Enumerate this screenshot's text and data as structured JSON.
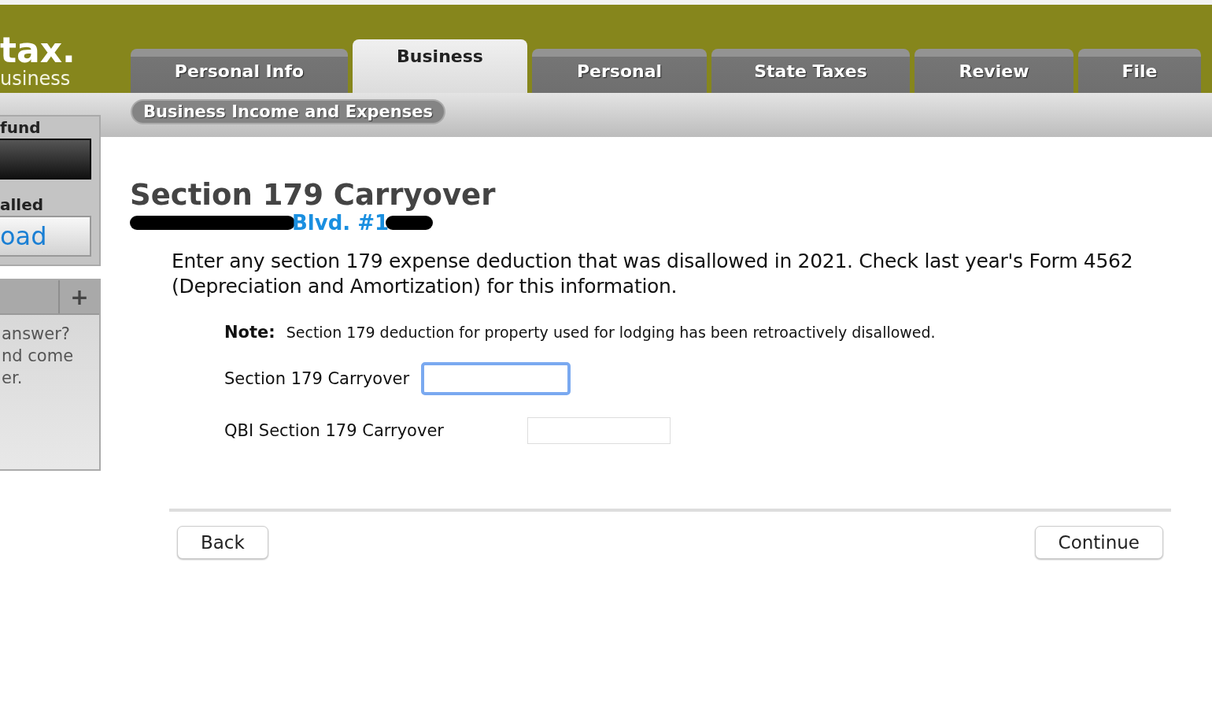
{
  "logo": {
    "mark": "tax.",
    "sub": "usiness"
  },
  "tabs": [
    {
      "label": "Personal Info",
      "selected": false
    },
    {
      "label": "Business",
      "selected": true
    },
    {
      "label": "Personal",
      "selected": false
    },
    {
      "label": "State Taxes",
      "selected": false
    },
    {
      "label": "Review",
      "selected": false
    },
    {
      "label": "File",
      "selected": false
    }
  ],
  "subnav": {
    "label": "Business Income and Expenses"
  },
  "sidebar": {
    "refund_label": "fund",
    "installed_label": "alled",
    "download_button": "oad",
    "help_add": "+",
    "help_lines": [
      "answer?",
      "nd come",
      "er."
    ]
  },
  "page": {
    "title": "Section 179 Carryover",
    "address_visible": "Blvd. #1",
    "intro": "Enter any section 179 expense deduction that was disallowed in 2021. Check last year's Form 4562 (Depreciation and Amortization) for this information.",
    "note_label": "Note:",
    "note_text": "Section 179 deduction for property used for lodging has been retroactively disallowed.",
    "fields": [
      {
        "label": "Section 179 Carryover",
        "focused": true
      },
      {
        "label": "QBI Section 179 Carryover",
        "focused": false
      }
    ]
  },
  "buttons": {
    "back": "Back",
    "continue": "Continue"
  }
}
